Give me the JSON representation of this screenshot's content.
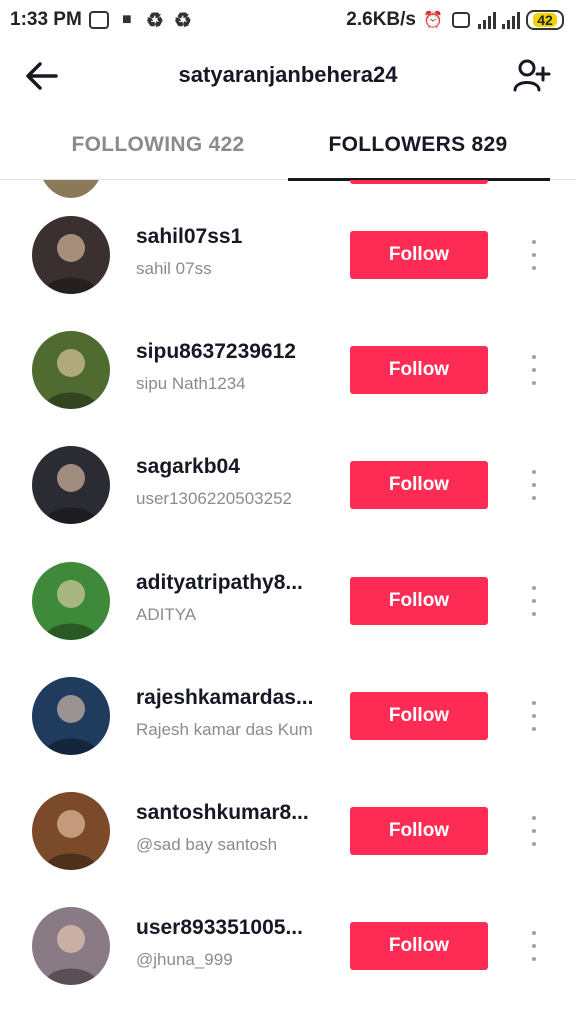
{
  "status_bar": {
    "time": "1:33 PM",
    "network_speed": "2.6KB/s",
    "battery": "42",
    "icons": [
      "notification-icon",
      "gallery-icon",
      "recycle-icon",
      "recycle-icon",
      "alarm-icon",
      "volte-icon",
      "signal-icon",
      "signal-icon",
      "battery-icon"
    ]
  },
  "header": {
    "title": "satyaranjanbehera24",
    "back_icon": "arrow-left-icon",
    "add_user_icon": "add-user-icon"
  },
  "tabs": [
    {
      "label": "FOLLOWING 422",
      "active": false
    },
    {
      "label": "FOLLOWERS 829",
      "active": true
    }
  ],
  "follow_label": "Follow",
  "colors": {
    "accent": "#fe2c55",
    "text_primary": "#161823",
    "text_secondary": "#8a8b91"
  },
  "followers": [
    {
      "username": "sahil07ss1",
      "nickname": "sahil 07ss",
      "avatar_color": "#3b3030"
    },
    {
      "username": "sipu8637239612",
      "nickname": "sipu Nath1234",
      "avatar_color": "#4f6b2f"
    },
    {
      "username": "sagarkb04",
      "nickname": "user1306220503252",
      "avatar_color": "#2b2b33"
    },
    {
      "username": "adityatripathy8...",
      "nickname": "ADITYA",
      "avatar_color": "#3f8a3a"
    },
    {
      "username": "rajeshkamardas...",
      "nickname": "Rajesh kamar das Kum",
      "avatar_color": "#1f3b5e"
    },
    {
      "username": "santoshkumar8...",
      "nickname": "@sad bay santosh",
      "avatar_color": "#7a4a2a"
    },
    {
      "username": "user893351005...",
      "nickname": "@jhuna_999",
      "avatar_color": "#8a7a86"
    }
  ]
}
